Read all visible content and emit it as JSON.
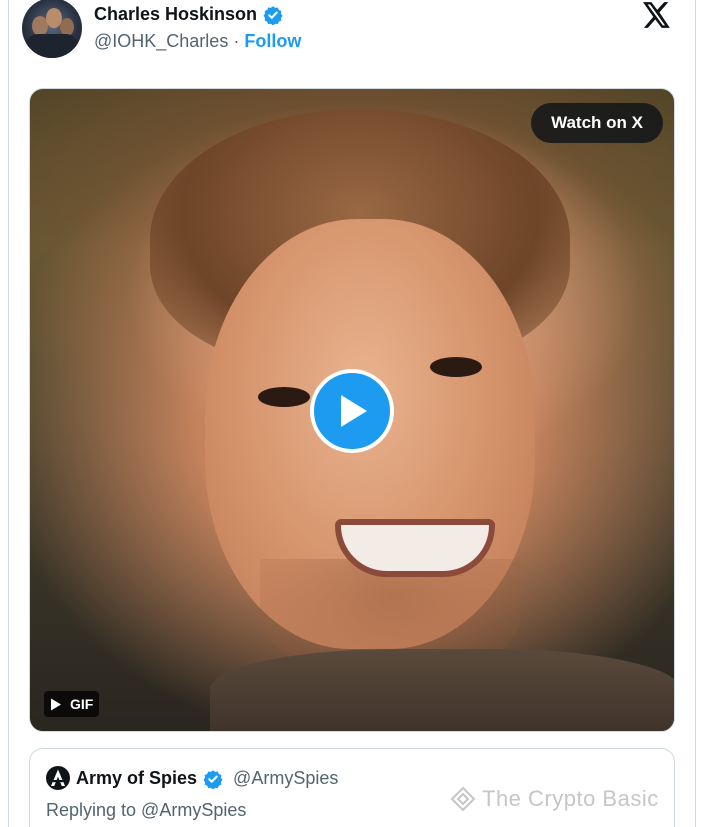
{
  "author": {
    "name": "Charles Hoskinson",
    "handle": "@IOHK_Charles",
    "separator": "·",
    "follow_label": "Follow",
    "verified_icon": "verified-badge-icon",
    "avatar_icon": "profile-photo"
  },
  "platform_logo": "x-logo-icon",
  "media": {
    "watch_label": "Watch on X",
    "gif_label": "GIF",
    "play_icon": "play-icon"
  },
  "quoted": {
    "name": "Army of Spies",
    "handle": "@ArmySpies",
    "reply_text": "Replying to @ArmySpies"
  },
  "watermark": {
    "text": "The Crypto Basic"
  },
  "colors": {
    "accent": "#1d9bf0",
    "text_primary": "#0f1419",
    "text_secondary": "#536471",
    "border": "#cfd9de"
  }
}
